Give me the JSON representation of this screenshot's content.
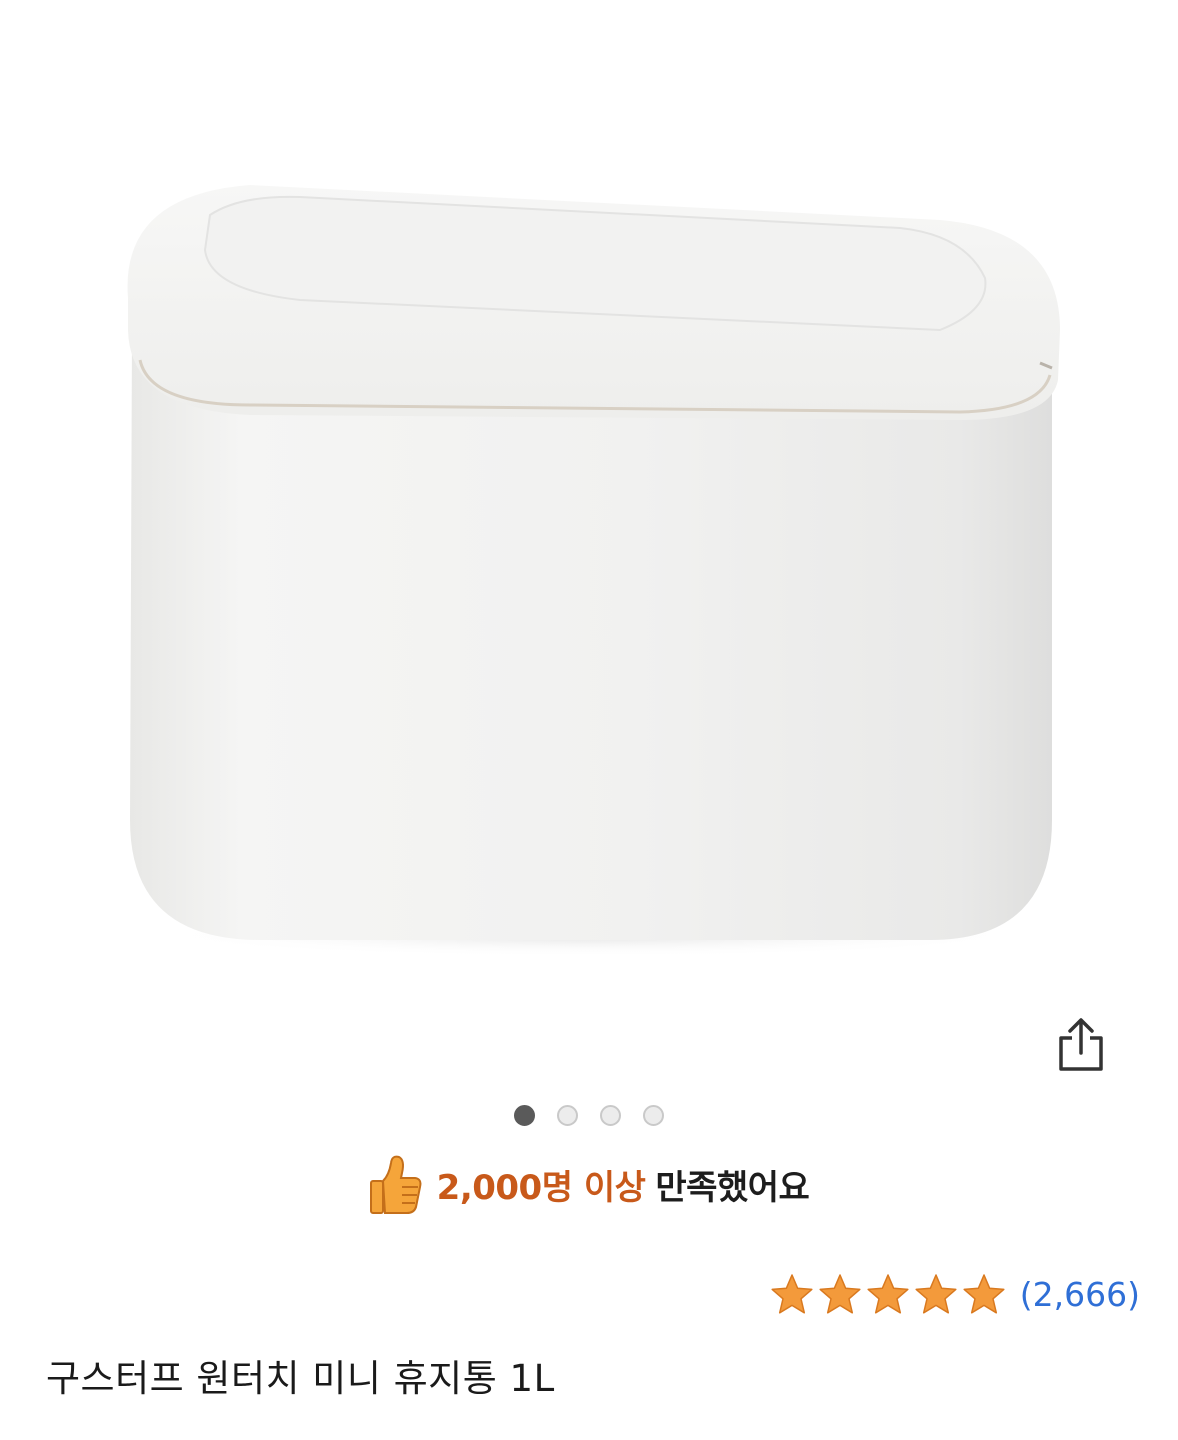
{
  "product": {
    "title": "구스터프 원터치 미니 휴지통 1L",
    "image_alt": "white oval mini trash bin with one-touch lid"
  },
  "gallery": {
    "total_images": 4,
    "active_index": 0
  },
  "share": {
    "icon": "share-icon"
  },
  "satisfaction": {
    "icon": "thumbs-up-icon",
    "highlight_text": "2,000명 이상",
    "rest_text": "만족했어요",
    "highlight_color": "#c8591a"
  },
  "rating": {
    "stars": 5,
    "max_stars": 5,
    "review_count_text": "(2,666)",
    "star_color": "#f39a3b",
    "count_color": "#2f6fd6"
  }
}
